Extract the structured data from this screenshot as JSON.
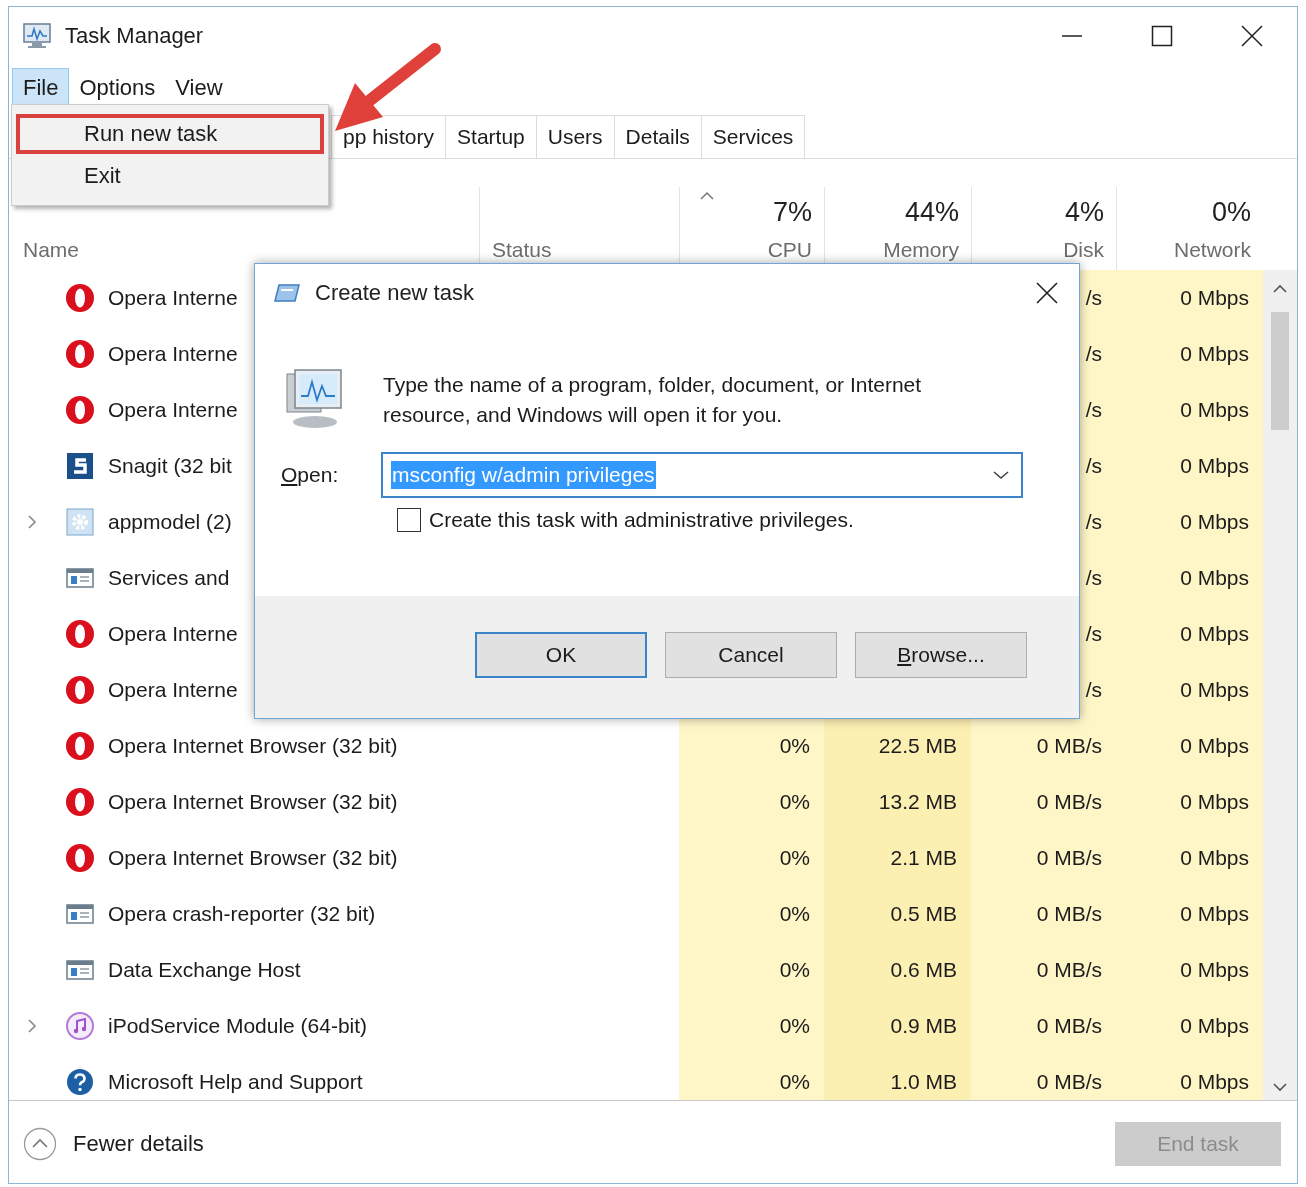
{
  "window": {
    "title": "Task Manager"
  },
  "menu_bar": [
    {
      "label": "File",
      "selected": true
    },
    {
      "label": "Options",
      "selected": false
    },
    {
      "label": "View",
      "selected": false
    }
  ],
  "file_menu": {
    "items": [
      {
        "label": "Run new task",
        "annotated": true
      },
      {
        "label": "Exit",
        "annotated": false
      }
    ]
  },
  "tabs": [
    {
      "label": "pp history"
    },
    {
      "label": "Startup"
    },
    {
      "label": "Users"
    },
    {
      "label": "Details"
    },
    {
      "label": "Services"
    }
  ],
  "table": {
    "columns": [
      {
        "label": "Name",
        "sorted": false
      },
      {
        "label": "Status",
        "sorted": false
      },
      {
        "label": "CPU",
        "total": "7%",
        "sorted": true
      },
      {
        "label": "Memory",
        "total": "44%",
        "sorted": false
      },
      {
        "label": "Disk",
        "total": "4%",
        "sorted": false
      },
      {
        "label": "Network",
        "total": "0%",
        "sorted": false
      }
    ],
    "rows": [
      {
        "kind": "ring",
        "expandable": false,
        "name": "Opera Interne",
        "disk": "/s",
        "network": "0 Mbps"
      },
      {
        "kind": "ring",
        "expandable": false,
        "name": "Opera Interne",
        "disk": "/s",
        "network": "0 Mbps"
      },
      {
        "kind": "ring",
        "expandable": false,
        "name": "Opera Interne",
        "disk": "/s",
        "network": "0 Mbps"
      },
      {
        "kind": "square",
        "expandable": false,
        "name": "Snagit (32 bit",
        "disk": "/s",
        "network": "0 Mbps"
      },
      {
        "kind": "gear",
        "expandable": true,
        "name": "appmodel (2)",
        "disk": "/s",
        "network": "0 Mbps"
      },
      {
        "kind": "window",
        "expandable": false,
        "name": "Services and",
        "disk": "/s",
        "network": "0 Mbps"
      },
      {
        "kind": "ring",
        "expandable": false,
        "name": "Opera Interne",
        "disk": "/s",
        "network": "0 Mbps"
      },
      {
        "kind": "ring",
        "expandable": false,
        "name": "Opera Interne",
        "disk": "/s",
        "network": "0 Mbps"
      },
      {
        "kind": "ring",
        "expandable": false,
        "name": "Opera Internet Browser (32 bit)",
        "cpu": "0%",
        "memory": "22.5 MB",
        "disk": "0 MB/s",
        "network": "0 Mbps"
      },
      {
        "kind": "ring",
        "expandable": false,
        "name": "Opera Internet Browser (32 bit)",
        "cpu": "0%",
        "memory": "13.2 MB",
        "disk": "0 MB/s",
        "network": "0 Mbps"
      },
      {
        "kind": "ring",
        "expandable": false,
        "name": "Opera Internet Browser (32 bit)",
        "cpu": "0%",
        "memory": "2.1 MB",
        "disk": "0 MB/s",
        "network": "0 Mbps"
      },
      {
        "kind": "window",
        "expandable": false,
        "name": "Opera crash-reporter (32 bit)",
        "cpu": "0%",
        "memory": "0.5 MB",
        "disk": "0 MB/s",
        "network": "0 Mbps"
      },
      {
        "kind": "window",
        "expandable": false,
        "name": "Data Exchange Host",
        "cpu": "0%",
        "memory": "0.6 MB",
        "disk": "0 MB/s",
        "network": "0 Mbps"
      },
      {
        "kind": "music",
        "expandable": true,
        "name": "iPodService Module (64-bit)",
        "cpu": "0%",
        "memory": "0.9 MB",
        "disk": "0 MB/s",
        "network": "0 Mbps"
      },
      {
        "kind": "help",
        "expandable": false,
        "name": "Microsoft Help and Support",
        "cpu": "0%",
        "memory": "1.0 MB",
        "disk": "0 MB/s",
        "network": "0 Mbps"
      }
    ]
  },
  "dialog": {
    "title": "Create new task",
    "message": "Type the name of a program, folder, document, or Internet resource, and Windows will open it for you.",
    "open_label": "Open:",
    "open_value": "msconfig w/admin privileges",
    "value_selected": true,
    "admin_checkbox": {
      "label": "Create this task with administrative privileges.",
      "checked": false
    },
    "buttons": [
      {
        "label": "OK",
        "default": true
      },
      {
        "label": "Cancel",
        "default": false
      },
      {
        "label": "Browse...",
        "default": false
      }
    ]
  },
  "footer": {
    "toggle": "Fewer details",
    "end_task": {
      "label": "End task",
      "disabled": true
    }
  }
}
